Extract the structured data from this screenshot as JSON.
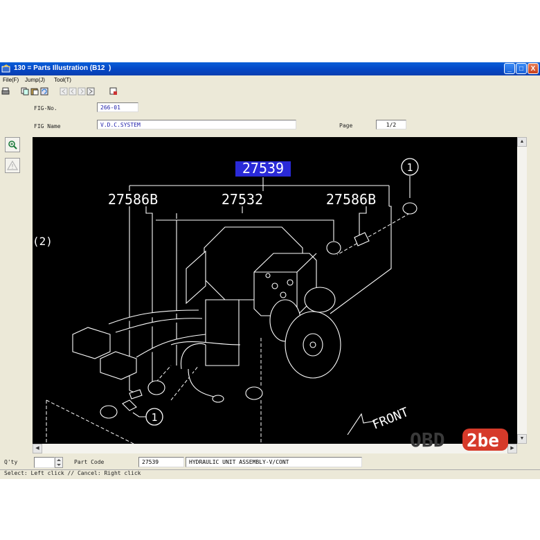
{
  "window": {
    "title": "130 = Parts Illustration (B12  )"
  },
  "titlebar_buttons": {
    "minimize": "_",
    "maximize": "□",
    "close": "X"
  },
  "menu": {
    "items": [
      "File(F)",
      "Jump(J)",
      "Tool(T)"
    ]
  },
  "toolbar": {
    "icons": [
      "print-icon",
      "copy-icon",
      "paste-icon",
      "refresh-icon",
      "nav-first-icon",
      "nav-prev-icon",
      "nav-next-icon",
      "nav-last-icon",
      "settings-icon"
    ]
  },
  "header": {
    "fig_no_label": "FIG-No.",
    "fig_no_value": "266-01",
    "fig_name_label": "FIG Name",
    "fig_name_value": "V.D.C.SYSTEM",
    "page_label": "Page",
    "page_value": "1/2"
  },
  "side_tools": [
    "zoom-in-icon",
    "warning-icon"
  ],
  "diagram": {
    "highlighted_part": "27539",
    "part_labels": [
      "27586B",
      "27532",
      "27586B"
    ],
    "callout_1": "1",
    "callout_2": "(2)",
    "front_label": "FRONT"
  },
  "bottom": {
    "qty_label": "Q'ty",
    "qty_value": "",
    "part_code_label": "Part Code",
    "part_code_value": "27539",
    "description_value": "HYDRAULIC UNIT ASSEMBLY-V/CONT"
  },
  "status_bar": {
    "text": "Select: Left click // Cancel: Right click"
  },
  "watermark": {
    "text_left": "OBD",
    "text_right": "2be"
  },
  "colors": {
    "titlebar": "#0a5fd8",
    "canvas_bg": "#000000",
    "line": "#ffffff",
    "highlight": "#2a2ad8",
    "field_text": "#1a1aa8"
  }
}
